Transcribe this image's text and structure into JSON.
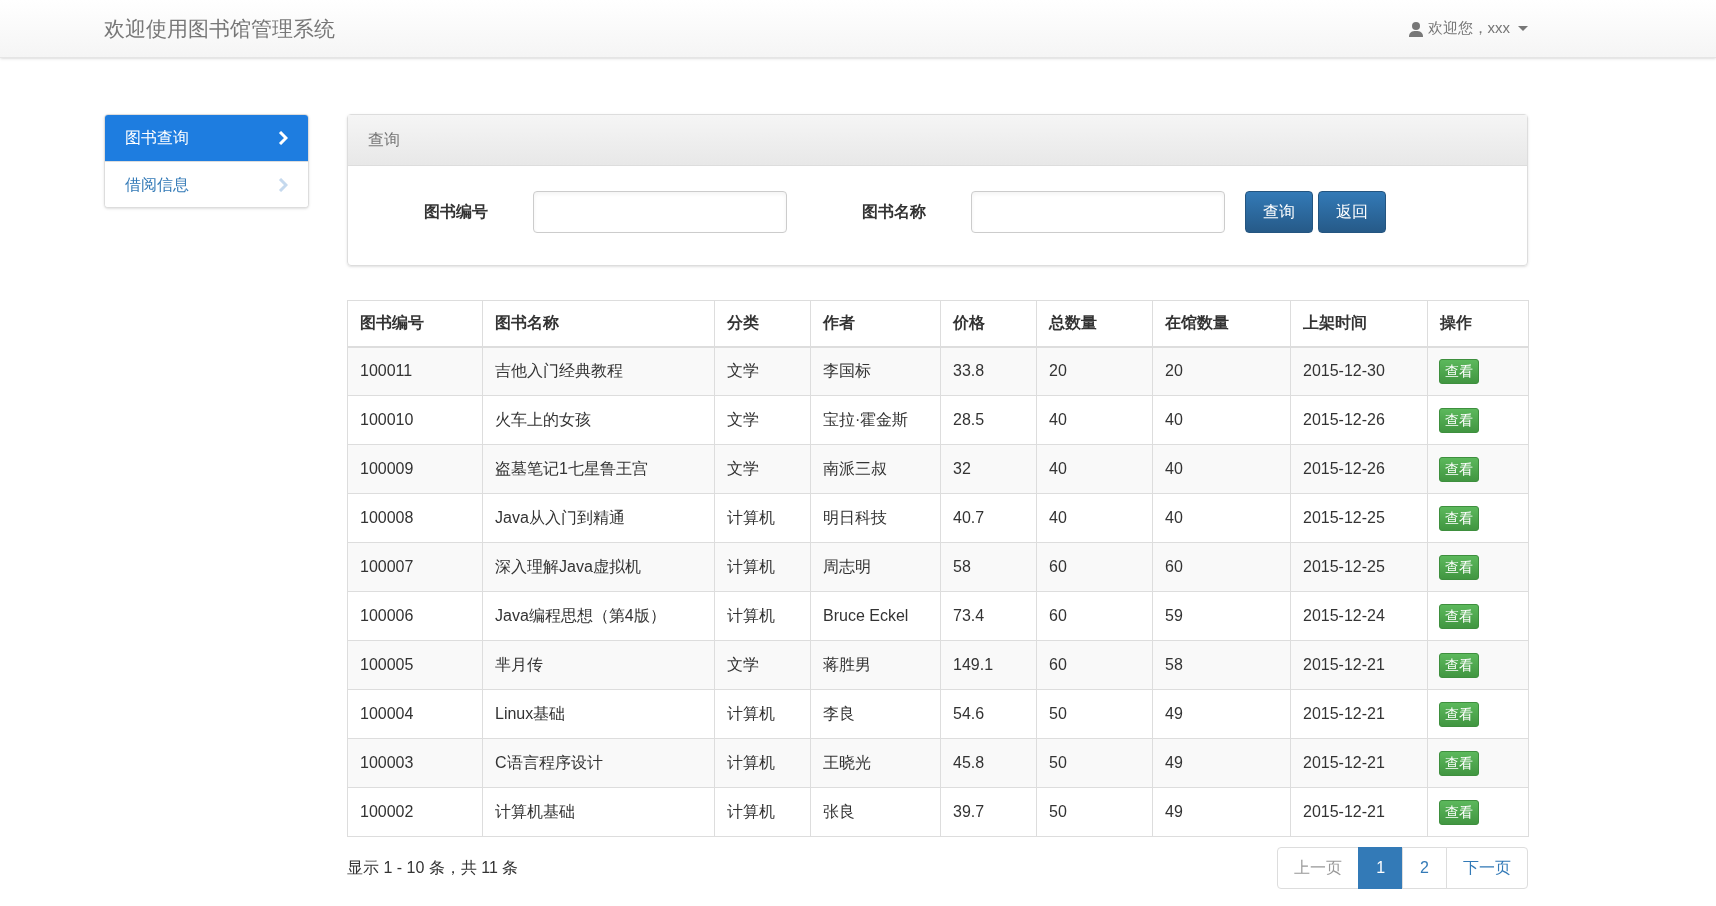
{
  "header": {
    "title": "欢迎使用图书馆管理系统",
    "user_menu": "欢迎您，xxx"
  },
  "sidebar": {
    "items": [
      {
        "label": "图书查询",
        "selected": true
      },
      {
        "label": "借阅信息",
        "selected": false
      }
    ]
  },
  "search_panel": {
    "title": "查询",
    "fields": [
      {
        "label": "图书编号"
      },
      {
        "label": "图书名称"
      }
    ],
    "buttons": [
      "查询",
      "返回"
    ]
  },
  "table": {
    "columns": [
      "图书编号",
      "图书名称",
      "分类",
      "作者",
      "价格",
      "总数量",
      "在馆数量",
      "上架时间",
      "操作"
    ],
    "rows": [
      [
        "100011",
        "吉他入门经典教程",
        "文学",
        "李国标",
        "33.8",
        "20",
        "20",
        "2015-12-30",
        "查看"
      ],
      [
        "100010",
        "火车上的女孩",
        "文学",
        "宝拉·霍金斯",
        "28.5",
        "40",
        "40",
        "2015-12-26",
        "查看"
      ],
      [
        "100009",
        "盗墓笔记1七星鲁王宫",
        "文学",
        "南派三叔",
        "32",
        "40",
        "40",
        "2015-12-26",
        "查看"
      ],
      [
        "100008",
        "Java从入门到精通",
        "计算机",
        "明日科技",
        "40.7",
        "40",
        "40",
        "2015-12-25",
        "查看"
      ],
      [
        "100007",
        "深入理解Java虚拟机",
        "计算机",
        "周志明",
        "58",
        "60",
        "60",
        "2015-12-25",
        "查看"
      ],
      [
        "100006",
        "Java编程思想（第4版）",
        "计算机",
        "Bruce Eckel",
        "73.4",
        "60",
        "59",
        "2015-12-24",
        "查看"
      ],
      [
        "100005",
        "芈月传",
        "文学",
        "蒋胜男",
        "149.1",
        "60",
        "58",
        "2015-12-21",
        "查看"
      ],
      [
        "100004",
        "Linux基础",
        "计算机",
        "李良",
        "54.6",
        "50",
        "49",
        "2015-12-21",
        "查看"
      ],
      [
        "100003",
        "C语言程序设计",
        "计算机",
        "王晓光",
        "45.8",
        "50",
        "49",
        "2015-12-21",
        "查看"
      ],
      [
        "100002",
        "计算机基础",
        "计算机",
        "张良",
        "39.7",
        "50",
        "49",
        "2015-12-21",
        "查看"
      ]
    ]
  },
  "footer": {
    "summary": "显示 1 - 10 条，共 11 条",
    "pagination": [
      {
        "label": "上一页",
        "kind": "prev",
        "disabled": true,
        "selected": false
      },
      {
        "label": "1",
        "kind": "page",
        "selected": true
      },
      {
        "label": "2",
        "kind": "page",
        "selected": false
      },
      {
        "label": "下一页",
        "kind": "next",
        "disabled": false,
        "selected": false
      }
    ]
  }
}
